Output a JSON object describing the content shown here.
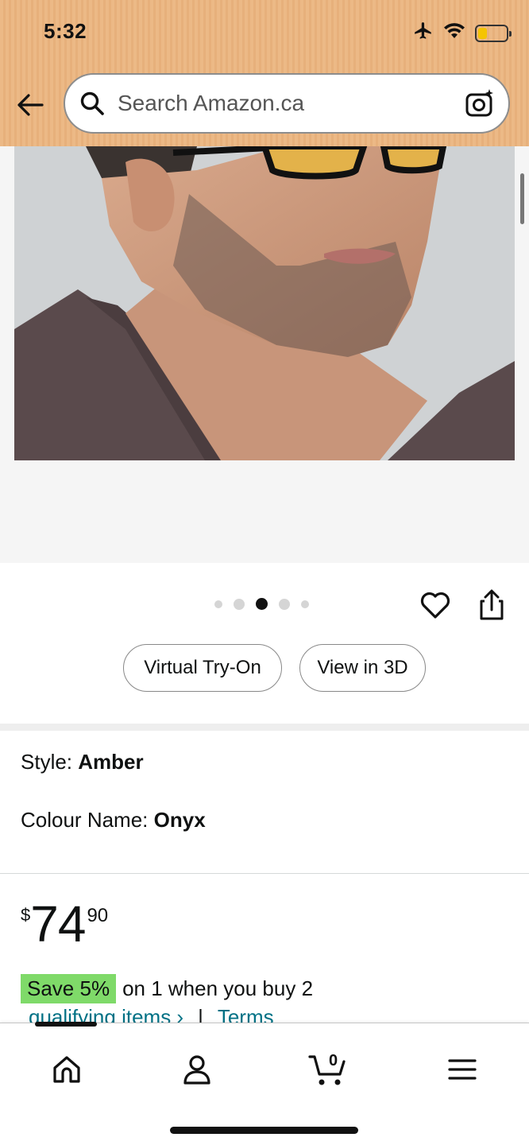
{
  "status_bar": {
    "time": "5:32",
    "icons": [
      "airplane-icon",
      "wifi-icon",
      "battery-icon"
    ],
    "battery_level": 0.3,
    "battery_color": "#f5c400"
  },
  "header": {
    "background": "#ecb986",
    "back_icon": "arrow-left-icon",
    "search_placeholder": "Search Amazon.ca",
    "search_value": "",
    "camera_icon": "camera-search-icon"
  },
  "gallery": {
    "image_alt": "Man wearing black glasses with amber lenses",
    "dot_count": 5,
    "active_dot": 3,
    "actions": [
      "heart-icon",
      "share-icon"
    ],
    "buttons": {
      "virtual_try_on": "Virtual Try-On",
      "view_in_3d": "View in 3D"
    }
  },
  "variation": {
    "style_label": "Style: ",
    "style_value": "Amber",
    "colour_label": "Colour Name: ",
    "colour_value": "Onyx"
  },
  "price": {
    "currency": "$",
    "whole": "74",
    "fraction": "90"
  },
  "promotion": {
    "badge": "Save 5%",
    "text": "on 1 when you buy 2",
    "link": "qualifying items ›",
    "separator": "|",
    "terms": "Terms",
    "badge_color": "#7fda69"
  },
  "bottom_nav": {
    "items": [
      "home-icon",
      "account-icon",
      "cart-icon",
      "menu-icon"
    ],
    "cart_count": "0",
    "active": "home"
  }
}
